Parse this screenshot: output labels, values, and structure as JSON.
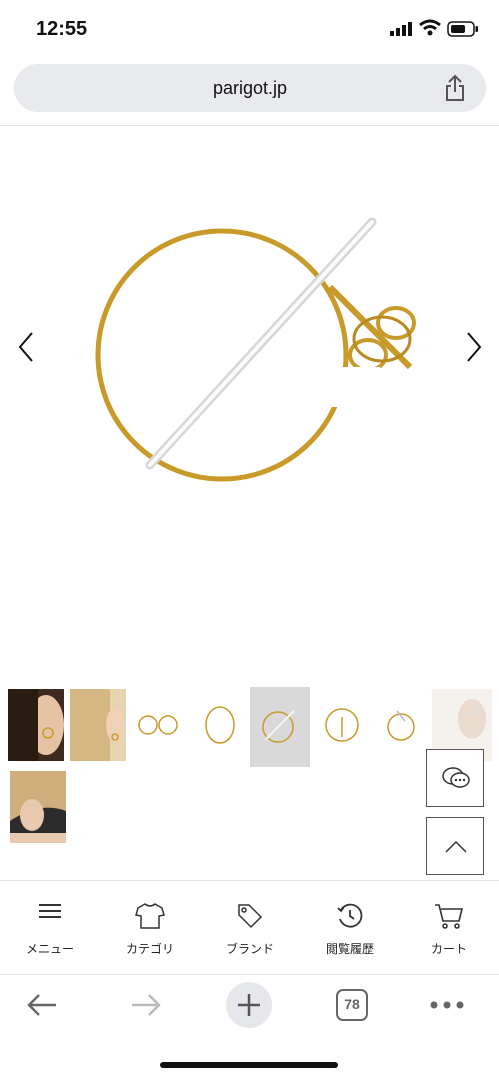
{
  "status": {
    "time": "12:55"
  },
  "browser": {
    "url": "parigot.jp",
    "tab_count": "78"
  },
  "nav": {
    "menu": "メニュー",
    "category": "カテゴリ",
    "brand": "ブランド",
    "history": "閲覧履歴",
    "cart": "カート"
  },
  "colors": {
    "gold": "#c89a2a",
    "silver": "#cfcfcf",
    "selected_thumb_bg": "#d9d9d9"
  }
}
